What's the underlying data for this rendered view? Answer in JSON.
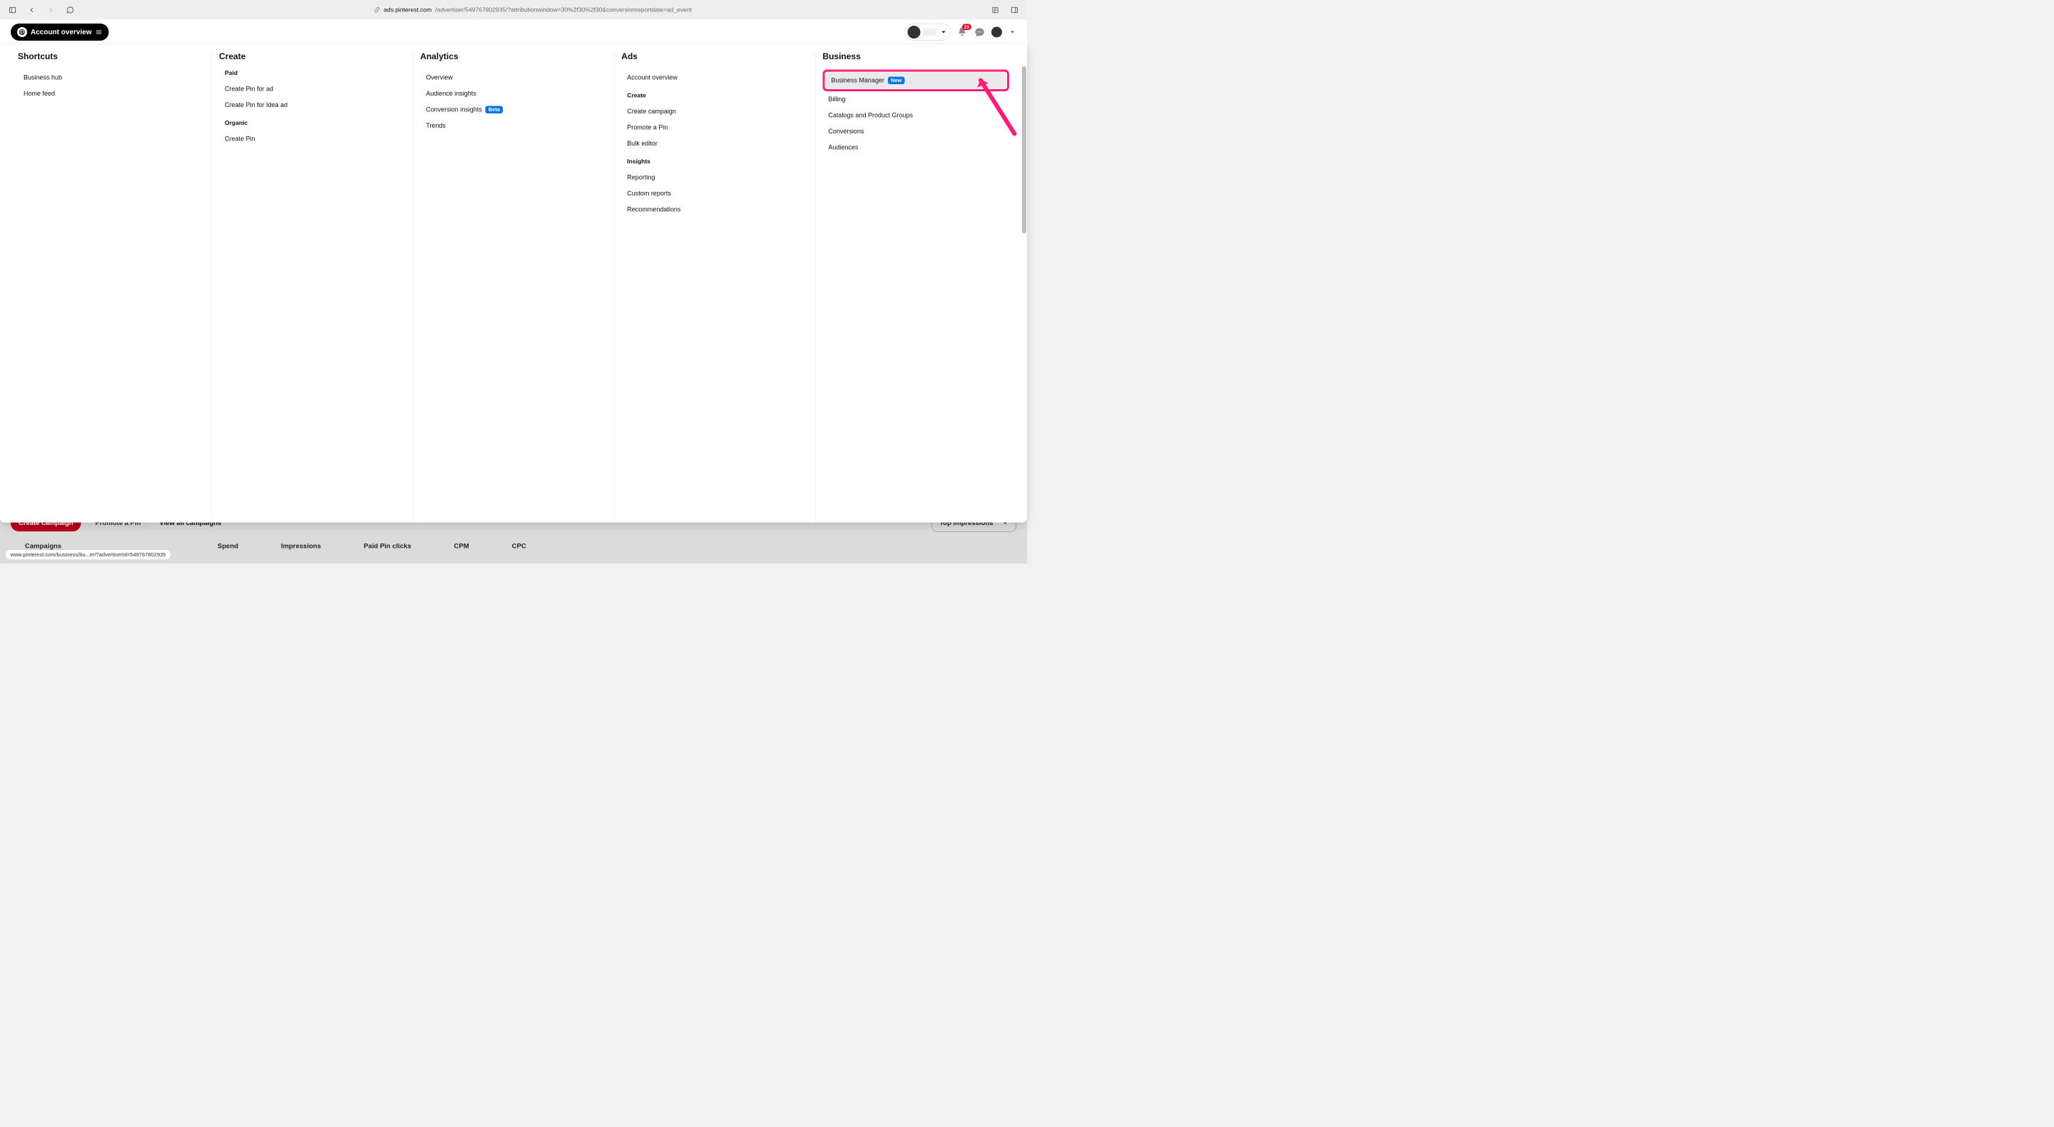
{
  "browser": {
    "url_domain": "ads.pinterest.com",
    "url_path": "/advertiser/549767802935/?attributionwindow=30%2f30%2f30&conversionreportdate=ad_event"
  },
  "header": {
    "account_pill": "Account overview",
    "notif_count": "23"
  },
  "mega": {
    "shortcuts": {
      "title": "Shortcuts",
      "items": [
        "Business hub",
        "Home feed"
      ]
    },
    "create": {
      "title": "Create",
      "paid_label": "Paid",
      "paid_items": [
        "Create Pin for ad",
        "Create Pin for Idea ad"
      ],
      "organic_label": "Organic",
      "organic_items": [
        "Create Pin"
      ]
    },
    "analytics": {
      "title": "Analytics",
      "items": [
        {
          "label": "Overview",
          "badge": ""
        },
        {
          "label": "Audience insights",
          "badge": ""
        },
        {
          "label": "Conversion insights",
          "badge": "Beta"
        },
        {
          "label": "Trends",
          "badge": ""
        }
      ]
    },
    "ads": {
      "title": "Ads",
      "top_items": [
        "Account overview"
      ],
      "create_label": "Create",
      "create_items": [
        "Create campaign",
        "Promote a Pin",
        "Bulk editor"
      ],
      "insights_label": "Insights",
      "insights_items": [
        "Reporting",
        "Custom reports",
        "Recommendations"
      ]
    },
    "business": {
      "title": "Business",
      "items": [
        {
          "label": "Business Manager",
          "badge": "New",
          "selected": true
        },
        {
          "label": "Billing",
          "badge": "",
          "selected": false
        },
        {
          "label": "Catalogs and Product Groups",
          "badge": "",
          "selected": false
        },
        {
          "label": "Conversions",
          "badge": "",
          "selected": false
        },
        {
          "label": "Audiences",
          "badge": "",
          "selected": false
        }
      ]
    }
  },
  "behind": {
    "btn_create": "Create campaign",
    "btn_promote": "Promote a Pin",
    "link_viewall": "View all campaigns",
    "dropdown": "Top impressions",
    "cols": [
      "Campaigns",
      "Spend",
      "Impressions",
      "Paid Pin clicks",
      "CPM",
      "CPC"
    ]
  },
  "status_url": "www.pinterest.com/business/bu...er/?advertiserId=549767802935"
}
